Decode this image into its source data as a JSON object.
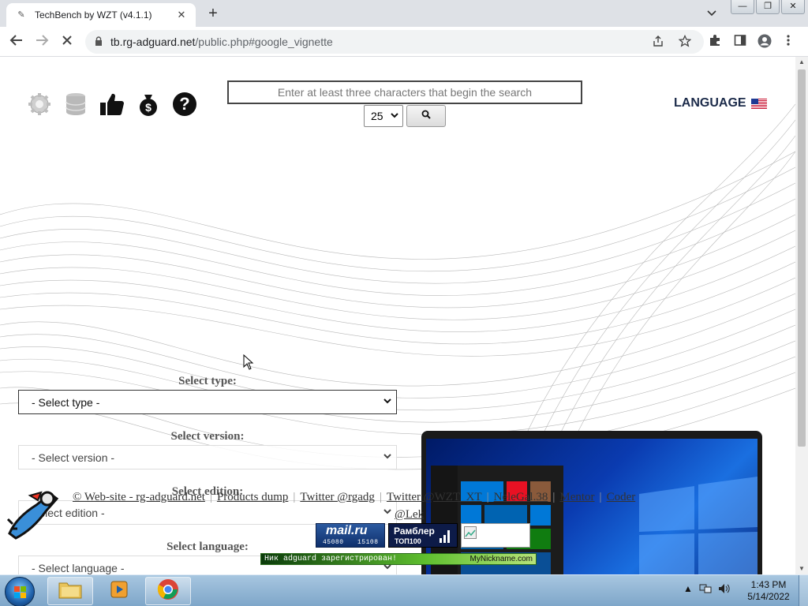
{
  "browser": {
    "tab": {
      "title": "TechBench by WZT (v4.1.1)",
      "close": "✕"
    },
    "new_tab": "+",
    "window_controls": {
      "minimize": "—",
      "restore": "❐",
      "close": "✕"
    },
    "url": {
      "host": "tb.rg-adguard.net",
      "path": "/public.php#google_vignette"
    }
  },
  "page": {
    "search": {
      "placeholder": "Enter at least three characters that begin the search",
      "value": ""
    },
    "results_count": "25",
    "language_label": "LANGUAGE",
    "selects": [
      {
        "label": "Select type:",
        "value": "- Select type -"
      },
      {
        "label": "Select version:",
        "value": "- Select version -"
      },
      {
        "label": "Select edition:",
        "value": "Select edition -"
      },
      {
        "label": "Select language:",
        "value": "- Select language -"
      }
    ],
    "footer": {
      "links": [
        "© Web-site - rg-adguard.net",
        "Products dump",
        "Twitter @rgadg",
        "Twitter @WZT_XT",
        "NeleGal.38",
        "Mentor",
        "Coder"
      ],
      "separator": "|",
      "line2": "@Lek"
    },
    "badges": {
      "mail": {
        "title": "mail.ru",
        "count1": "45080",
        "count2": "15108"
      },
      "rambler": {
        "title": "Рамблер",
        "subtitle": "ТОП100"
      },
      "nickname": {
        "left": "Ник adguard зарегистрирован!",
        "right": "MyNickname.com"
      }
    }
  },
  "taskbar": {
    "time": "1:43 PM",
    "date": "5/14/2022"
  },
  "colors": {
    "lang_text": "#1c2b4a",
    "taskbar": "#8fb3d4",
    "accent_blue": "#0078d7"
  }
}
